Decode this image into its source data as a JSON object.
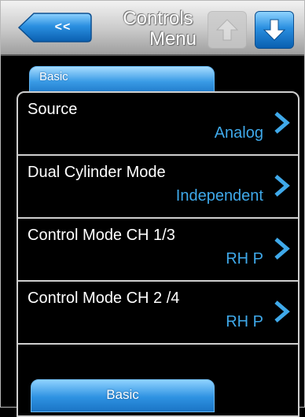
{
  "header": {
    "back_label": "<<",
    "title_line1": "Controls",
    "title_line2": "Menu",
    "up_button_icon": "arrow-up-icon",
    "down_button_icon": "arrow-down-icon"
  },
  "tab": {
    "label": "Basic"
  },
  "rows": [
    {
      "label": "Source",
      "value": "Analog"
    },
    {
      "label": "Dual Cylinder Mode",
      "value": "Independent"
    },
    {
      "label": "Control Mode CH 1/3",
      "value": "RH P"
    },
    {
      "label": "Control Mode CH 2 /4",
      "value": "RH P"
    }
  ],
  "bottom_button": {
    "label": "Basic"
  },
  "colors": {
    "accent_blue": "#3fa9ea",
    "header_gray": "#c9c9c9",
    "background": "#000000"
  }
}
